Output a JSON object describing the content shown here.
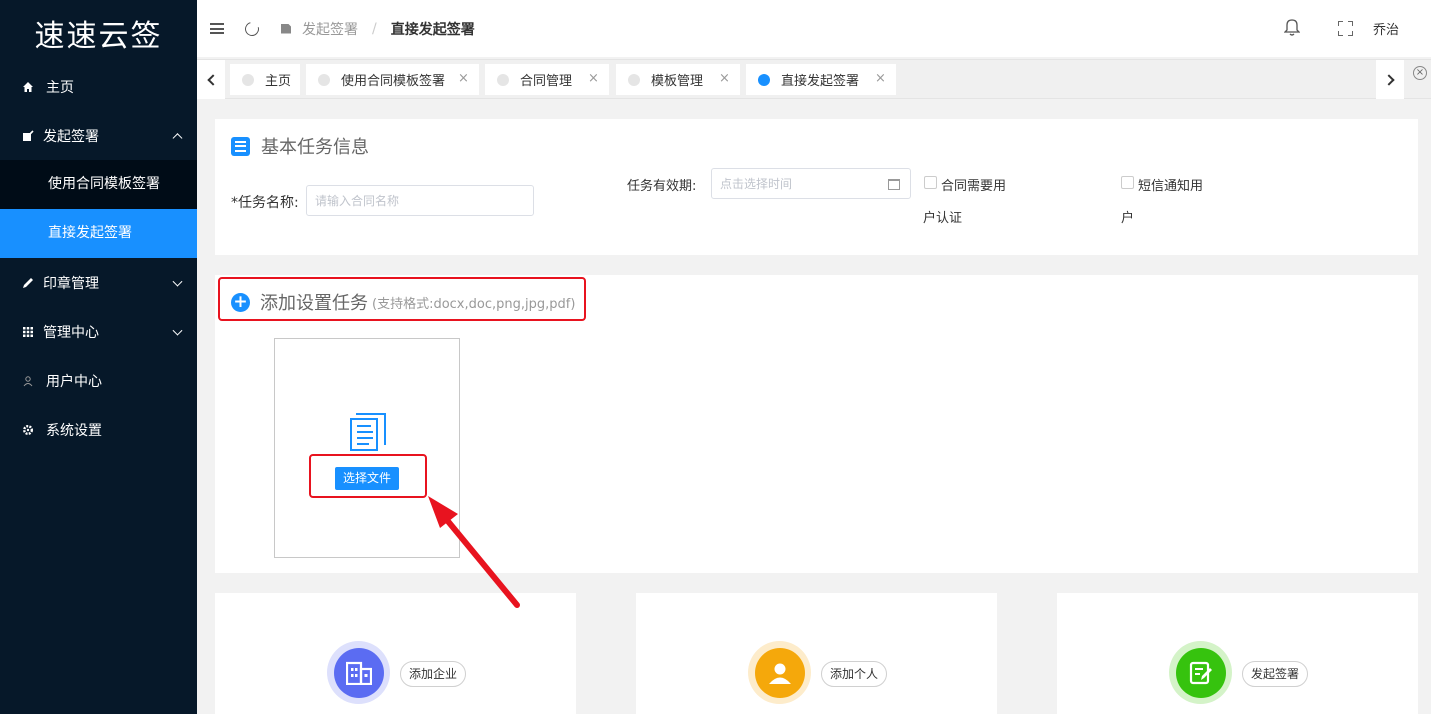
{
  "app": {
    "logo": "速速云签"
  },
  "sidebar": {
    "items": [
      {
        "label": "主页",
        "icon": "home-icon"
      },
      {
        "label": "发起签署",
        "icon": "edit-icon",
        "expanded": true,
        "children": [
          {
            "label": "使用合同模板签署",
            "active": false
          },
          {
            "label": "直接发起签署",
            "active": true
          }
        ]
      },
      {
        "label": "印章管理",
        "icon": "pen-icon",
        "expandable": true
      },
      {
        "label": "管理中心",
        "icon": "grid-icon",
        "expandable": true
      },
      {
        "label": "用户中心",
        "icon": "user-icon"
      },
      {
        "label": "系统设置",
        "icon": "gear-icon"
      }
    ]
  },
  "header": {
    "breadcrumb": {
      "parent": "发起签署",
      "separator": "/",
      "current": "直接发起签署"
    },
    "user": "乔治"
  },
  "tabs": [
    {
      "label": "主页",
      "closable": false,
      "active": false
    },
    {
      "label": "使用合同模板签署",
      "closable": true,
      "active": false
    },
    {
      "label": "合同管理",
      "closable": true,
      "active": false
    },
    {
      "label": "模板管理",
      "closable": true,
      "active": false
    },
    {
      "label": "直接发起签署",
      "closable": true,
      "active": true
    }
  ],
  "basic": {
    "title": "基本任务信息",
    "task_name_label": "*任务名称:",
    "task_name_placeholder": "请输入合同名称",
    "validity_label": "任务有效期:",
    "validity_placeholder": "点击选择时间",
    "contract_auth_line1": "合同需要用",
    "contract_auth_line2": "户认证",
    "sms_line1": "短信通知用",
    "sms_line2": "户"
  },
  "upload": {
    "title": "添加设置任务",
    "hint": "(支持格式:docx,doc,png,jpg,pdf)",
    "select_button": "选择文件"
  },
  "roles": [
    {
      "label": "添加企业",
      "color": "#5b6cf2",
      "ring": "#dde0fc",
      "icon": "building-icon"
    },
    {
      "label": "添加个人",
      "color": "#f5a80b",
      "ring": "#fdeccb",
      "icon": "person-icon"
    },
    {
      "label": "发起签署",
      "color": "#36c30e",
      "ring": "#d4f3c8",
      "icon": "sign-icon"
    }
  ],
  "colors": {
    "accent": "#1890ff",
    "sidebar": "#061829",
    "highlight": "#e8131f"
  }
}
